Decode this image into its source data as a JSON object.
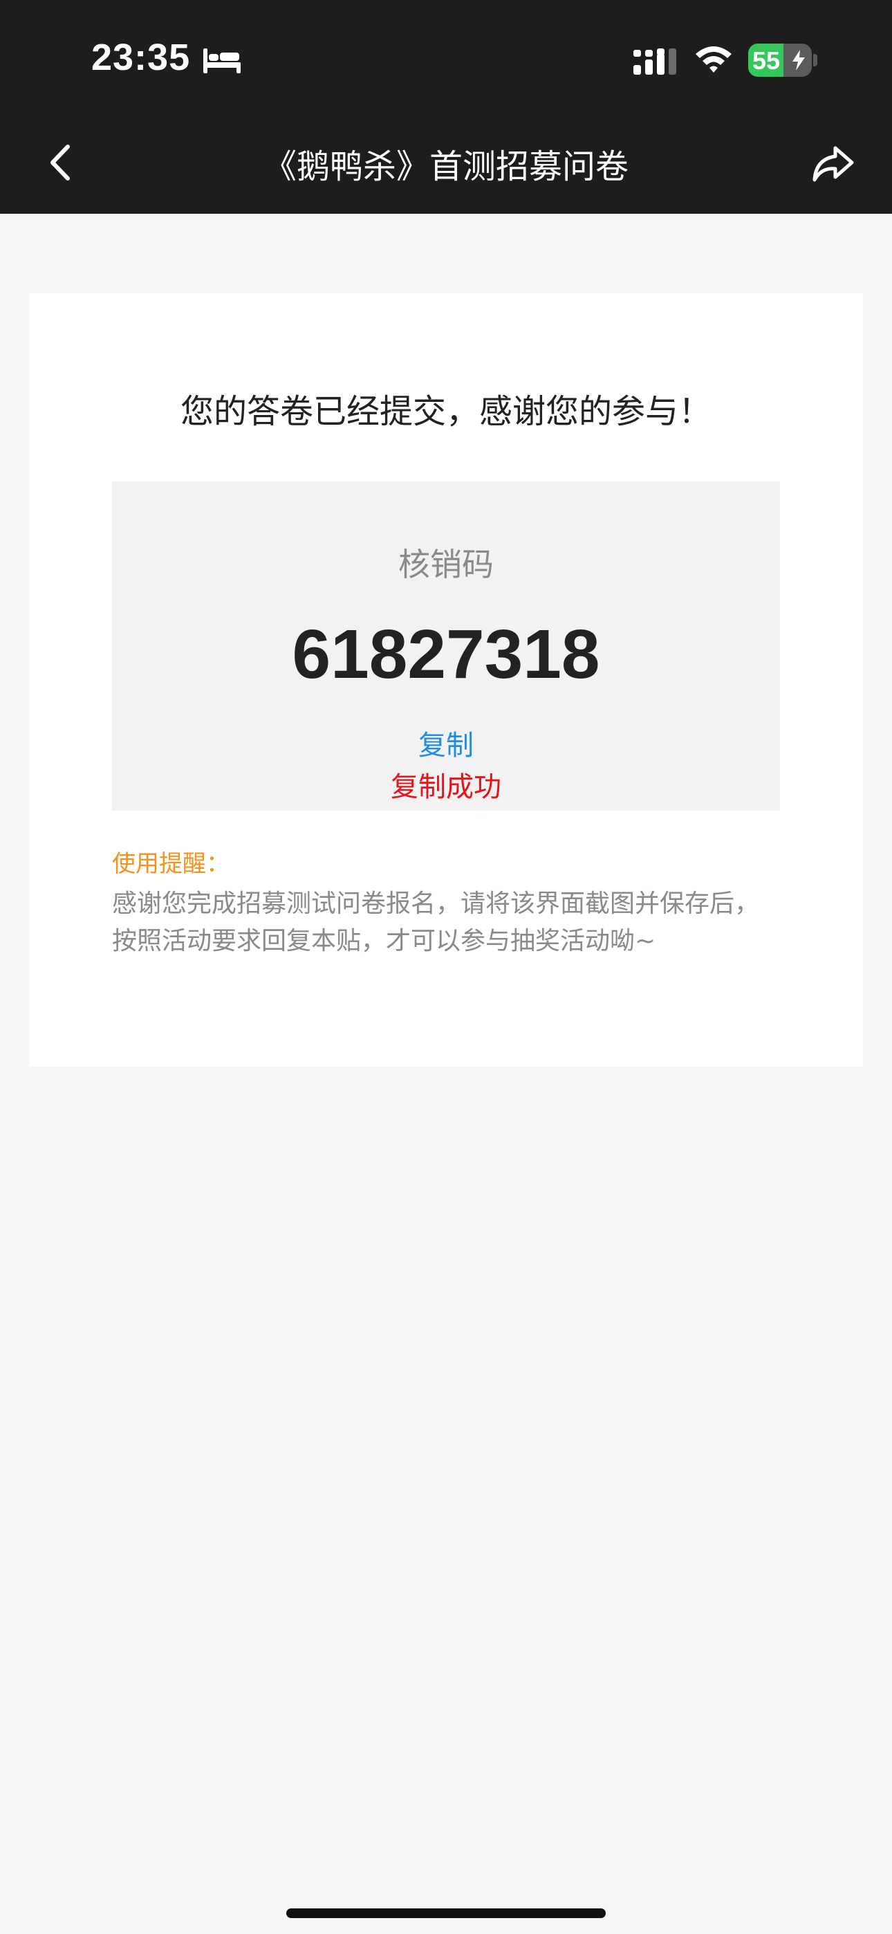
{
  "status_bar": {
    "time": "23:35",
    "battery_percent": "55",
    "battery_level": 0.55,
    "icons": [
      "bed-icon",
      "cellular-signal-icon",
      "wifi-icon",
      "battery-icon",
      "charging-bolt-icon"
    ]
  },
  "nav": {
    "title": "《鹅鸭杀》首测招募问卷",
    "back_icon": "chevron-left-icon",
    "share_icon": "share-icon"
  },
  "result": {
    "message": "您的答卷已经提交，感谢您的参与！",
    "code_label": "核销码",
    "code_value": "61827318",
    "copy_label": "复制",
    "copy_status": "复制成功"
  },
  "reminder": {
    "title": "使用提醒：",
    "body": "感谢您完成招募测试问卷报名，请将该界面截图并保存后，按照活动要求回复本贴，才可以参与抽奖活动呦~"
  },
  "colors": {
    "header_bg": "#1d1d1d",
    "page_bg": "#f6f6f6",
    "card_bg": "#ffffff",
    "code_box_bg": "#f2f2f2",
    "copy_link": "#1e8de6",
    "copy_success": "#e3141b",
    "reminder_title": "#f5921e",
    "battery_green": "#34c759"
  }
}
